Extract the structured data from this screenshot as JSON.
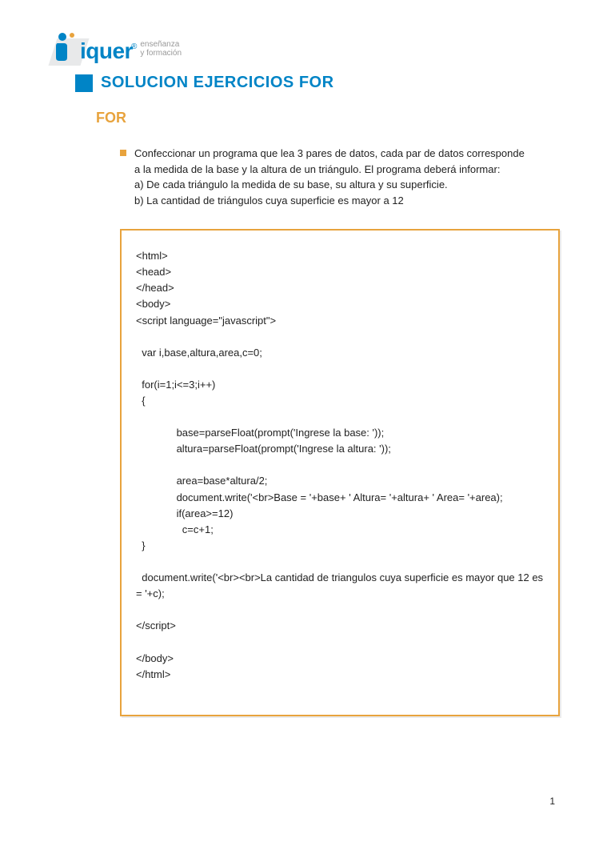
{
  "logo": {
    "brand": "iquer",
    "tagline1": "enseñanza",
    "tagline2": "y formación"
  },
  "title": "SOLUCION EJERCICIOS FOR",
  "subtitle": "FOR",
  "bullet": {
    "line1": "Confeccionar un programa que lea 3 pares de datos, cada par de datos corresponde a la medida de la base y la altura de un triángulo. El programa deberá informar:",
    "line2": " a) De cada triángulo la medida de su base, su altura y su superficie.",
    "line3": "b) La cantidad de triángulos cuya superficie es mayor a 12"
  },
  "code": {
    "l1": "<html>",
    "l2": "<head>",
    "l3": "</head>",
    "l4": "<body>",
    "l5": "<script language=\"javascript\">",
    "l6": "  var i,base,altura,area,c=0;",
    "l7": "  for(i=1;i<=3;i++)",
    "l8": "  {",
    "l9": "              base=parseFloat(prompt('Ingrese la base: '));",
    "l10": "              altura=parseFloat(prompt('Ingrese la altura: '));",
    "l11": "              area=base*altura/2;",
    "l12": "              document.write('<br>Base = '+base+ ' Altura= '+altura+ ' Area= '+area);",
    "l13": "              if(area>=12)",
    "l14": "                c=c+1;",
    "l15": "  }",
    "l16": "  document.write('<br><br>La cantidad de triangulos cuya superficie es mayor que 12 es  = '+c);",
    "l17": "</script>",
    "l18": "</body>",
    "l19": "</html>"
  },
  "pageNumber": "1"
}
